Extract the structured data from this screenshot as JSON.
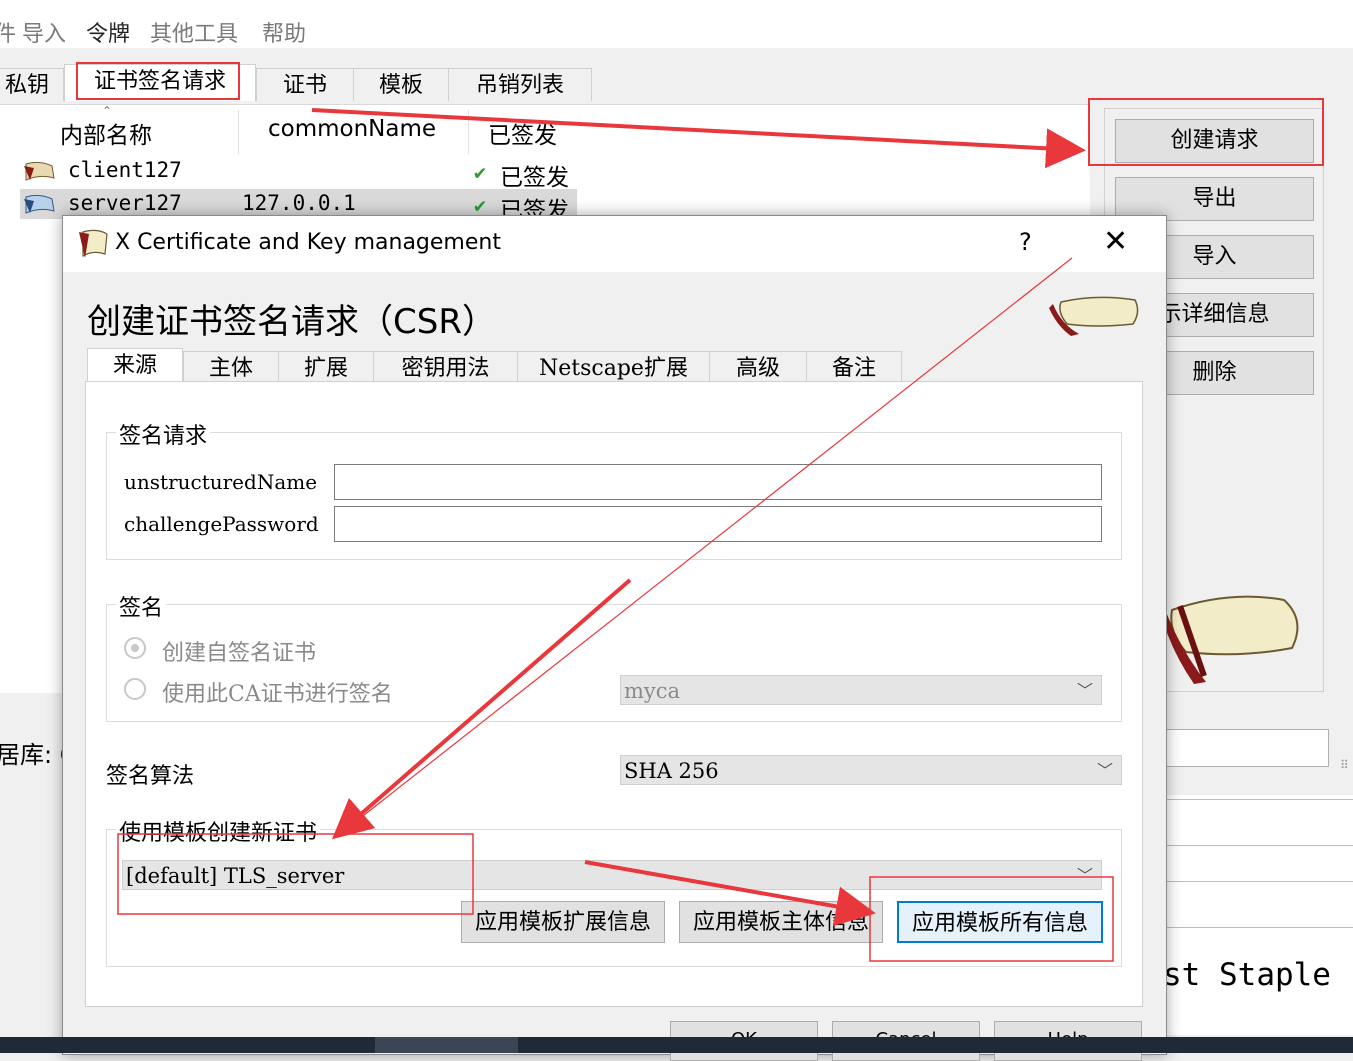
{
  "menu": {
    "items": [
      "件",
      "导入",
      "令牌",
      "其他工具",
      "帮助"
    ]
  },
  "main_tabs": [
    "私钥",
    "证书签名请求",
    "证书",
    "模板",
    "吊销列表"
  ],
  "csr_list": {
    "headers": [
      "内部名称",
      "commonName",
      "已签发"
    ],
    "rows": [
      {
        "name": "client127",
        "common_name": "",
        "signed": "已签发"
      },
      {
        "name": "server127",
        "common_name": "127.0.0.1",
        "signed": "已签发"
      }
    ]
  },
  "side_buttons": {
    "create": "创建请求",
    "export": "导出",
    "import": "导入",
    "details": "示详细信息",
    "delete": "删除"
  },
  "database_label": "居库: C:",
  "bg_peek_text": "st Staple",
  "dialog": {
    "title": "X Certificate and Key management",
    "help": "?",
    "close": "✕",
    "heading": "创建证书签名请求（CSR）",
    "tabs": [
      "来源",
      "主体",
      "扩展",
      "密钥用法",
      "Netscape扩展",
      "高级",
      "备注"
    ],
    "sign_request_group": {
      "title": "签名请求",
      "unstructured_label": "unstructuredName",
      "unstructured_value": "",
      "challenge_label": "challengePassword",
      "challenge_value": ""
    },
    "signing_group": {
      "title": "签名",
      "self_sign": "创建自签名证书",
      "use_ca": "使用此CA证书进行签名",
      "ca_value": "myca"
    },
    "algorithm_label": "签名算法",
    "algorithm_value": "SHA 256",
    "template_group": {
      "title": "使用模板创建新证书",
      "value": "[default] TLS_server",
      "apply_ext": "应用模板扩展信息",
      "apply_subject": "应用模板主体信息",
      "apply_all": "应用模板所有信息"
    },
    "footer": {
      "ok": "OK",
      "cancel": "Cancel",
      "help": "Help"
    }
  },
  "colors": {
    "annotation": "#e8383b",
    "check": "#2e9b2e",
    "focus": "#0078d7"
  }
}
